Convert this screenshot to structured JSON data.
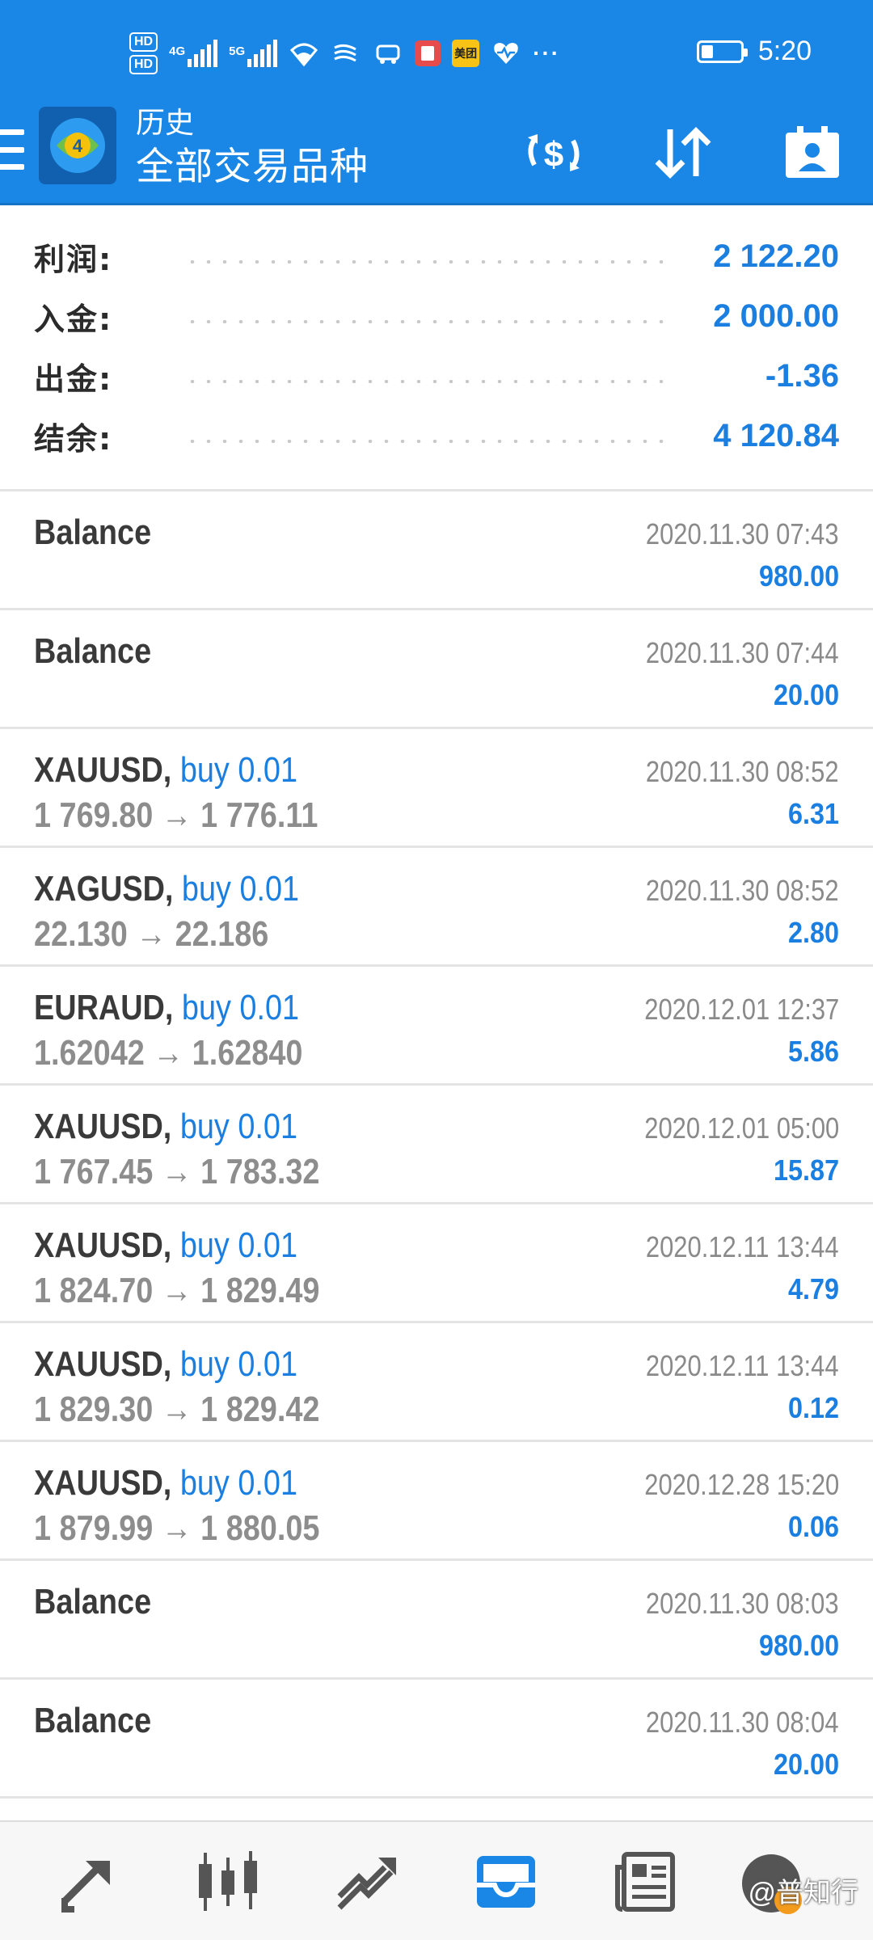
{
  "status_bar": {
    "hd1": "HD",
    "hd2": "HD",
    "net1": "4G",
    "net2": "5G",
    "app_badge": "美团",
    "more": "···",
    "battery_level": 0.3,
    "time": "5:20"
  },
  "toolbar": {
    "title": "历史",
    "subtitle": "全部交易品种"
  },
  "summary": [
    {
      "label": "利润:",
      "value": "2 122.20"
    },
    {
      "label": "入金:",
      "value": "2 000.00"
    },
    {
      "label": "出金:",
      "value": "-1.36"
    },
    {
      "label": "结余:",
      "value": "4 120.84"
    }
  ],
  "history": [
    {
      "symbol": "Balance",
      "side": "",
      "prices": "",
      "time": "2020.11.30 07:43",
      "profit": "980.00"
    },
    {
      "symbol": "Balance",
      "side": "",
      "prices": "",
      "time": "2020.11.30 07:44",
      "profit": "20.00"
    },
    {
      "symbol": "XAUUSD,",
      "side": " buy 0.01",
      "prices": "1 769.80 → 1 776.11",
      "time": "2020.11.30 08:52",
      "profit": "6.31"
    },
    {
      "symbol": "XAGUSD,",
      "side": " buy 0.01",
      "prices": "22.130 → 22.186",
      "time": "2020.11.30 08:52",
      "profit": "2.80"
    },
    {
      "symbol": "EURAUD,",
      "side": " buy 0.01",
      "prices": "1.62042 → 1.62840",
      "time": "2020.12.01 12:37",
      "profit": "5.86"
    },
    {
      "symbol": "XAUUSD,",
      "side": " buy 0.01",
      "prices": "1 767.45 → 1 783.32",
      "time": "2020.12.01 05:00",
      "profit": "15.87"
    },
    {
      "symbol": "XAUUSD,",
      "side": " buy 0.01",
      "prices": "1 824.70 → 1 829.49",
      "time": "2020.12.11 13:44",
      "profit": "4.79"
    },
    {
      "symbol": "XAUUSD,",
      "side": " buy 0.01",
      "prices": "1 829.30 → 1 829.42",
      "time": "2020.12.11 13:44",
      "profit": "0.12"
    },
    {
      "symbol": "XAUUSD,",
      "side": " buy 0.01",
      "prices": "1 879.99 → 1 880.05",
      "time": "2020.12.28 15:20",
      "profit": "0.06"
    },
    {
      "symbol": "Balance",
      "side": "",
      "prices": "",
      "time": "2020.11.30 08:03",
      "profit": "980.00"
    },
    {
      "symbol": "Balance",
      "side": "",
      "prices": "",
      "time": "2020.11.30 08:04",
      "profit": "20.00"
    }
  ],
  "bottom_nav": {
    "items": [
      "quotes-icon",
      "chart-icon",
      "trade-icon",
      "history-icon",
      "news-icon",
      "messages-icon"
    ],
    "active": "history-icon"
  },
  "watermark": "@普知行",
  "colors": {
    "header": "#1a87e6",
    "accent_blue": "#1a7fe0",
    "text_dark": "#3a3a3a",
    "text_gray": "#8d8d8d",
    "divider": "#e4e4e4"
  }
}
